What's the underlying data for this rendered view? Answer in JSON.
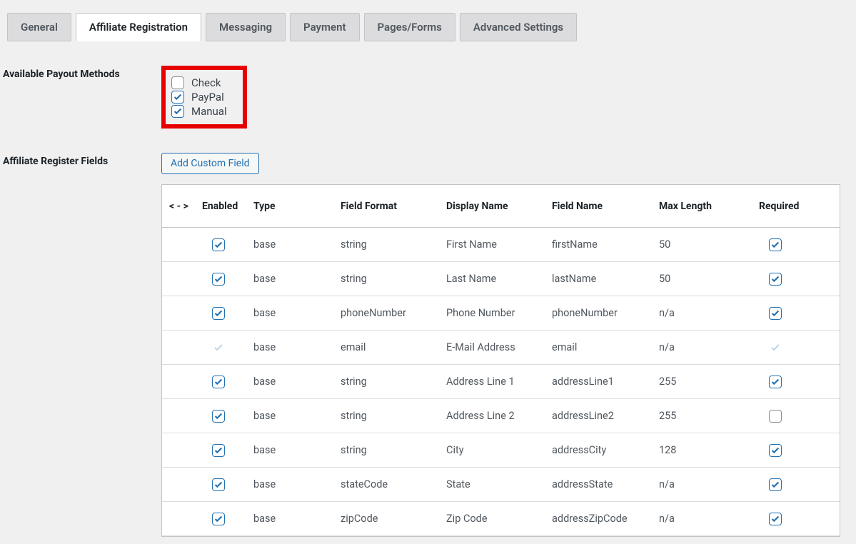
{
  "tabs": [
    {
      "label": "General",
      "active": false
    },
    {
      "label": "Affiliate Registration",
      "active": true
    },
    {
      "label": "Messaging",
      "active": false
    },
    {
      "label": "Payment",
      "active": false
    },
    {
      "label": "Pages/Forms",
      "active": false
    },
    {
      "label": "Advanced Settings",
      "active": false
    }
  ],
  "payout": {
    "label": "Available Payout Methods",
    "items": [
      {
        "label": "Check",
        "checked": false
      },
      {
        "label": "PayPal",
        "checked": true
      },
      {
        "label": "Manual",
        "checked": true
      }
    ]
  },
  "register": {
    "label": "Affiliate Register Fields",
    "add_button": "Add Custom Field",
    "headers": {
      "handle": "< - >",
      "enabled": "Enabled",
      "type": "Type",
      "format": "Field Format",
      "display": "Display Name",
      "fieldname": "Field Name",
      "maxlen": "Max Length",
      "required": "Required"
    },
    "rows": [
      {
        "enabled": true,
        "enabled_locked": false,
        "type": "base",
        "format": "string",
        "display": "First Name",
        "fieldname": "firstName",
        "maxlen": "50",
        "required": true,
        "required_locked": false
      },
      {
        "enabled": true,
        "enabled_locked": false,
        "type": "base",
        "format": "string",
        "display": "Last Name",
        "fieldname": "lastName",
        "maxlen": "50",
        "required": true,
        "required_locked": false
      },
      {
        "enabled": true,
        "enabled_locked": false,
        "type": "base",
        "format": "phoneNumber",
        "display": "Phone Number",
        "fieldname": "phoneNumber",
        "maxlen": "n/a",
        "required": true,
        "required_locked": false
      },
      {
        "enabled": true,
        "enabled_locked": true,
        "type": "base",
        "format": "email",
        "display": "E-Mail Address",
        "fieldname": "email",
        "maxlen": "n/a",
        "required": true,
        "required_locked": true
      },
      {
        "enabled": true,
        "enabled_locked": false,
        "type": "base",
        "format": "string",
        "display": "Address Line 1",
        "fieldname": "addressLine1",
        "maxlen": "255",
        "required": true,
        "required_locked": false
      },
      {
        "enabled": true,
        "enabled_locked": false,
        "type": "base",
        "format": "string",
        "display": "Address Line 2",
        "fieldname": "addressLine2",
        "maxlen": "255",
        "required": false,
        "required_locked": false
      },
      {
        "enabled": true,
        "enabled_locked": false,
        "type": "base",
        "format": "string",
        "display": "City",
        "fieldname": "addressCity",
        "maxlen": "128",
        "required": true,
        "required_locked": false
      },
      {
        "enabled": true,
        "enabled_locked": false,
        "type": "base",
        "format": "stateCode",
        "display": "State",
        "fieldname": "addressState",
        "maxlen": "n/a",
        "required": true,
        "required_locked": false
      },
      {
        "enabled": true,
        "enabled_locked": false,
        "type": "base",
        "format": "zipCode",
        "display": "Zip Code",
        "fieldname": "addressZipCode",
        "maxlen": "n/a",
        "required": true,
        "required_locked": false
      }
    ]
  }
}
